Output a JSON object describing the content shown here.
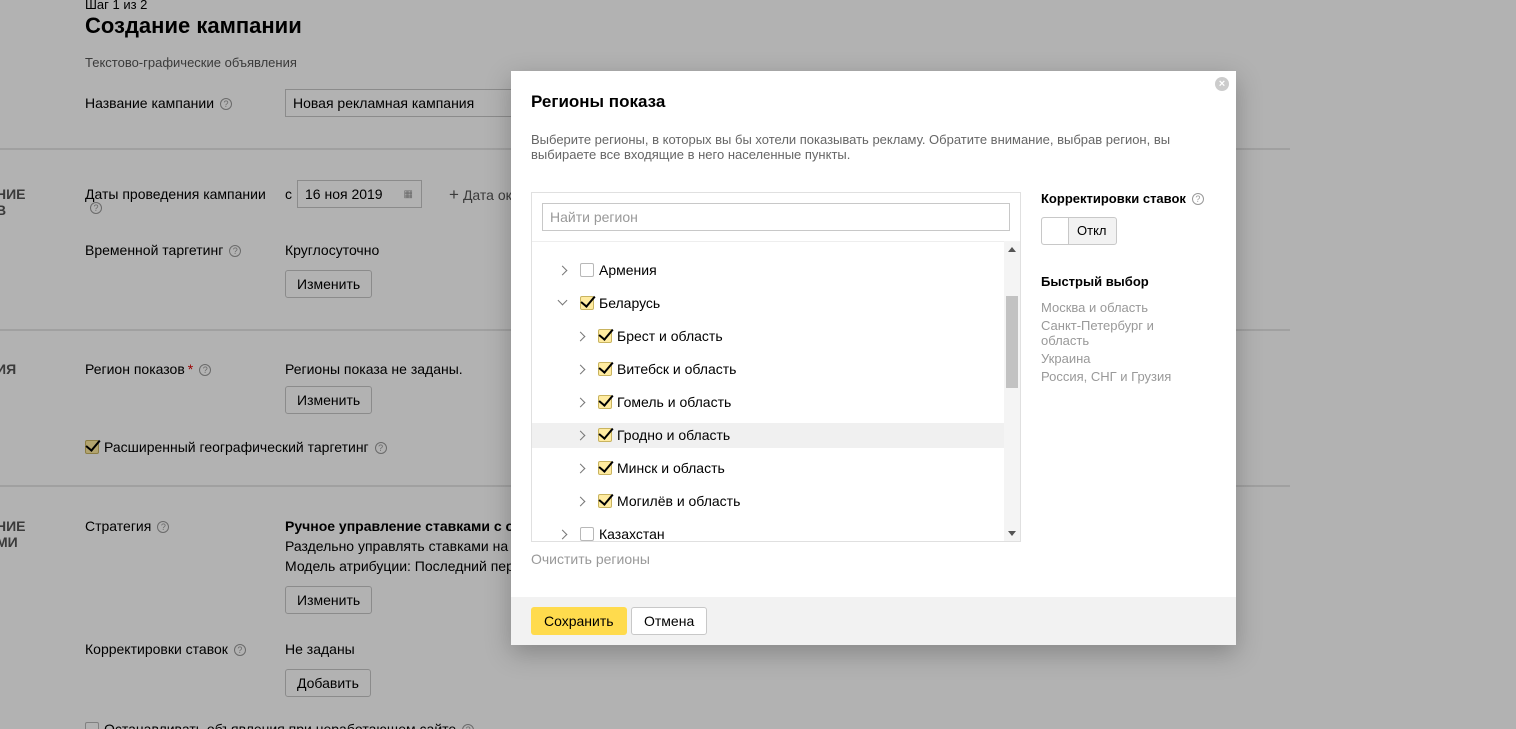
{
  "page": {
    "step": "Шаг 1 из 2",
    "title": "Создание кампании",
    "subtitle": "Текстово-графические объявления",
    "name_label": "Название кампании",
    "name_value": "Новая рекламная кампания",
    "section_a_left": "НИЕ\nВ",
    "dates_label": "Даты проведения кампании",
    "dates_prefix": "с",
    "dates_value": "16 ноя 2019",
    "add_date_label": "Дата ок",
    "time_label": "Временной таргетинг",
    "time_value": "Круглосуточно",
    "change_label": "Изменить",
    "section_b_left": "ИЯ",
    "region_label": "Регион показов",
    "region_required": "*",
    "region_value": "Регионы показа не заданы.",
    "extended_geo_label": "Расширенный географический таргетинг",
    "section_c_left": "НИЕ\nМИ",
    "strategy_label": "Стратегия",
    "strategy_title": "Ручное управление ставками с опти",
    "strategy_line1": "Раздельно управлять ставками на пос",
    "strategy_line2": "Модель атрибуции: Последний перех",
    "bids_label": "Корректировки ставок",
    "bids_value": "Не заданы",
    "add_label": "Добавить",
    "stop_label": "Останавливать объявления при неработающем сайте"
  },
  "modal": {
    "title": "Регионы показа",
    "description": "Выберите регионы, в которых вы бы хотели показывать рекламу. Обратите внимание, выбрав регион, вы выбираете все входящие в него населенные пункты.",
    "search_placeholder": "Найти регион",
    "regions": [
      {
        "label": "Армения",
        "level": 0,
        "checked": false,
        "expanded": false
      },
      {
        "label": "Беларусь",
        "level": 0,
        "checked": true,
        "expanded": true
      },
      {
        "label": "Брест и область",
        "level": 1,
        "checked": true,
        "expanded": false
      },
      {
        "label": "Витебск и область",
        "level": 1,
        "checked": true,
        "expanded": false
      },
      {
        "label": "Гомель и область",
        "level": 1,
        "checked": true,
        "expanded": false
      },
      {
        "label": "Гродно и область",
        "level": 1,
        "checked": true,
        "expanded": false,
        "highlighted": true
      },
      {
        "label": "Минск и область",
        "level": 1,
        "checked": true,
        "expanded": false
      },
      {
        "label": "Могилёв и область",
        "level": 1,
        "checked": true,
        "expanded": false
      },
      {
        "label": "Казахстан",
        "level": 0,
        "checked": false,
        "expanded": false
      }
    ],
    "clear_label": "Очистить регионы",
    "bids_title": "Корректировки ставок",
    "toggle_label": "Откл",
    "quick_title": "Быстрый выбор",
    "quick_items": [
      "Москва и область",
      "Санкт-Петербург и область",
      "Украина",
      "Россия, СНГ и Грузия"
    ],
    "save_label": "Сохранить",
    "cancel_label": "Отмена"
  }
}
